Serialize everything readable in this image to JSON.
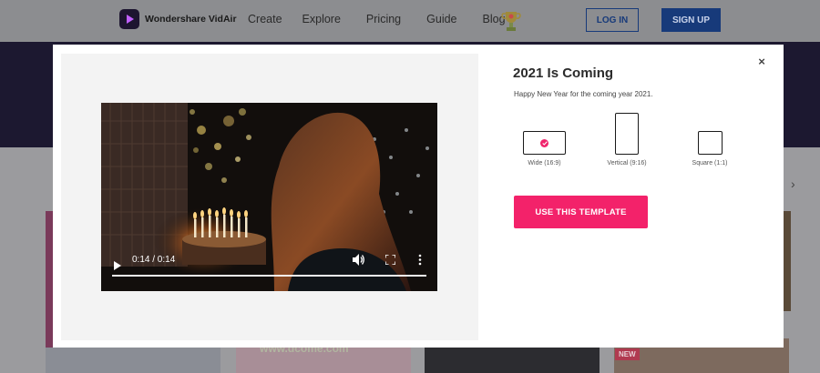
{
  "nav": {
    "brand": "Wondershare VidAir",
    "links": [
      "Create",
      "Explore",
      "Pricing",
      "Guide",
      "Blog"
    ],
    "login": "LOG IN",
    "signup": "SIGN UP"
  },
  "background": {
    "new_badge": "NEW",
    "watermark": "www.dcome.com"
  },
  "modal": {
    "close": "×",
    "title": "2021 Is Coming",
    "subtitle": "Happy New Year for the coming year 2021.",
    "ratios": [
      {
        "label": "Wide (16:9)",
        "selected": true
      },
      {
        "label": "Vertical (9:16)",
        "selected": false
      },
      {
        "label": "Square (1:1)",
        "selected": false
      }
    ],
    "cta": "USE THIS TEMPLATE",
    "video": {
      "time": "0:14 / 0:14",
      "progress": 1.0
    }
  },
  "colors": {
    "accent": "#f3226a",
    "nav_button": "#173a7a",
    "hero": "#1c1830"
  },
  "icons": {
    "play": "play-icon",
    "volume": "volume-icon",
    "fullscreen": "fullscreen-icon",
    "more": "more-vertical-icon",
    "close": "close-icon"
  }
}
